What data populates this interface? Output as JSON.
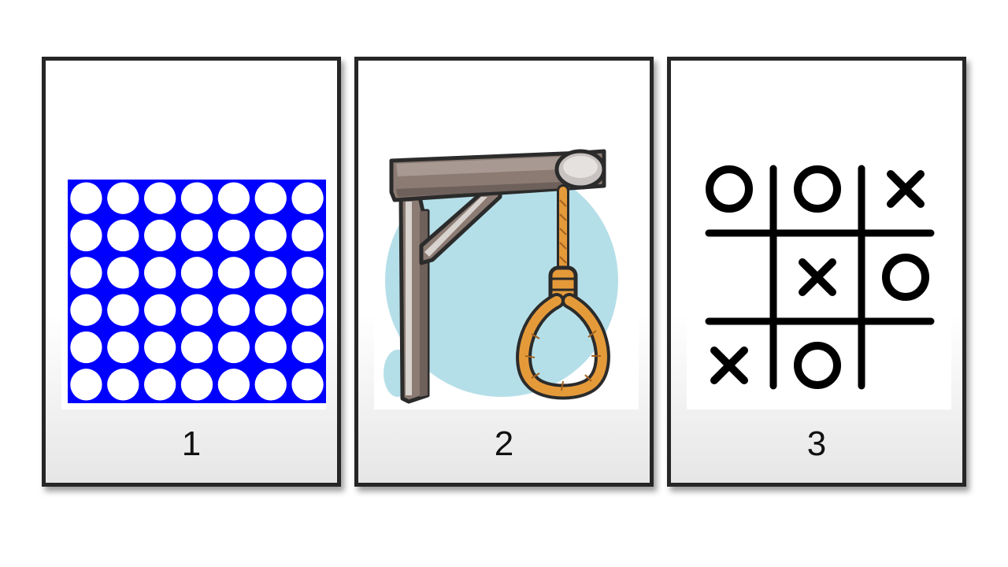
{
  "cards": [
    {
      "label": "1",
      "art": "connect-four-board",
      "board_color": "#0000ff",
      "columns": 7,
      "rows": 6
    },
    {
      "label": "2",
      "art": "hangman-gallows"
    },
    {
      "label": "3",
      "art": "tic-tac-toe-board",
      "board": [
        [
          "O",
          "O",
          "X"
        ],
        [
          "",
          "X",
          "O"
        ],
        [
          "X",
          "O",
          ""
        ]
      ]
    }
  ],
  "colors": {
    "frame": "#262626",
    "gallows_wood": "#8b7b73",
    "rope": "#e59a3a",
    "backdrop": "#b5dfe8"
  }
}
